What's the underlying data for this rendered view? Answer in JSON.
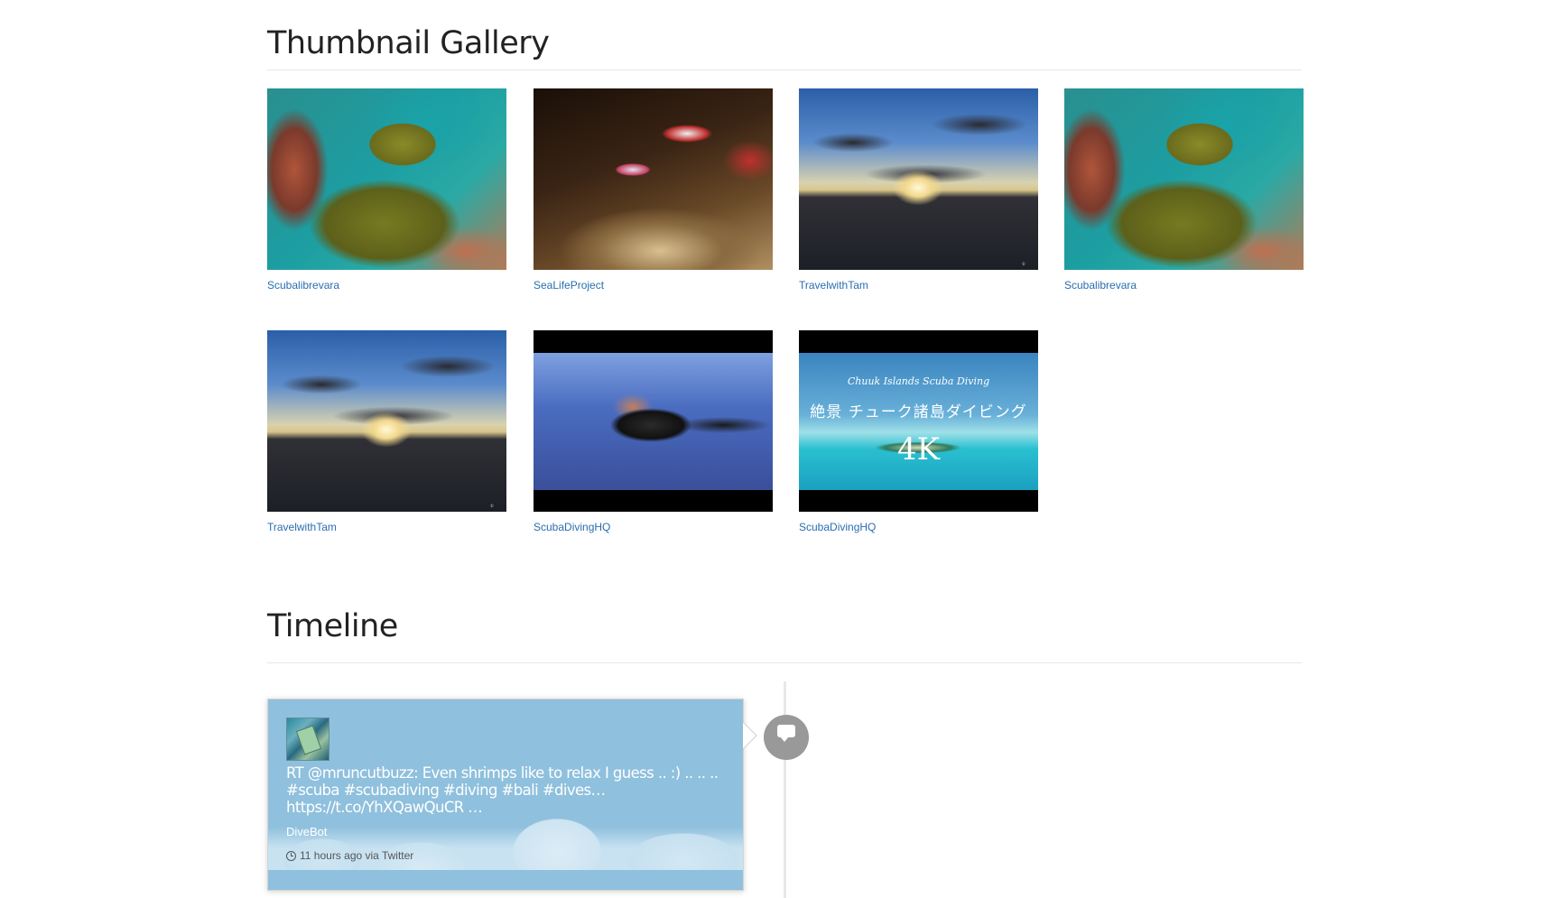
{
  "gallery": {
    "title": "Thumbnail Gallery",
    "items": [
      {
        "caption": "Scubalibrevara",
        "image": "moray-eel-reef"
      },
      {
        "caption": "SeaLifeProject",
        "image": "cleaner-shrimp"
      },
      {
        "caption": "TravelwithTam",
        "image": "ocean-sunset"
      },
      {
        "caption": "Scubalibrevara",
        "image": "moray-eel-reef"
      },
      {
        "caption": "TravelwithTam",
        "image": "ocean-sunset"
      },
      {
        "caption": "ScubaDivingHQ",
        "image": "scuba-divers"
      },
      {
        "caption": "ScubaDivingHQ",
        "image": "chuuk-islands-video"
      }
    ],
    "chuuk_overlay": {
      "line1": "Chuuk Islands Scuba Diving",
      "line2": "絶景 チューク諸島ダイビング",
      "line3": "4K"
    }
  },
  "timeline": {
    "title": "Timeline",
    "entries": [
      {
        "avatar_icon": "avatar-icon",
        "badge_icon": "comment-icon",
        "text": "RT @mruncutbuzz: Even shrimps like to relax I guess .. :) .. .. .. #scuba #scubadiving #diving #bali #dives… https://t.co/YhXQawQuCR …",
        "author": "DiveBot",
        "time": "11 hours ago via Twitter"
      }
    ]
  },
  "colors": {
    "link": "#2a6db0",
    "panel": "#8fc0dd",
    "badge": "#999999"
  }
}
